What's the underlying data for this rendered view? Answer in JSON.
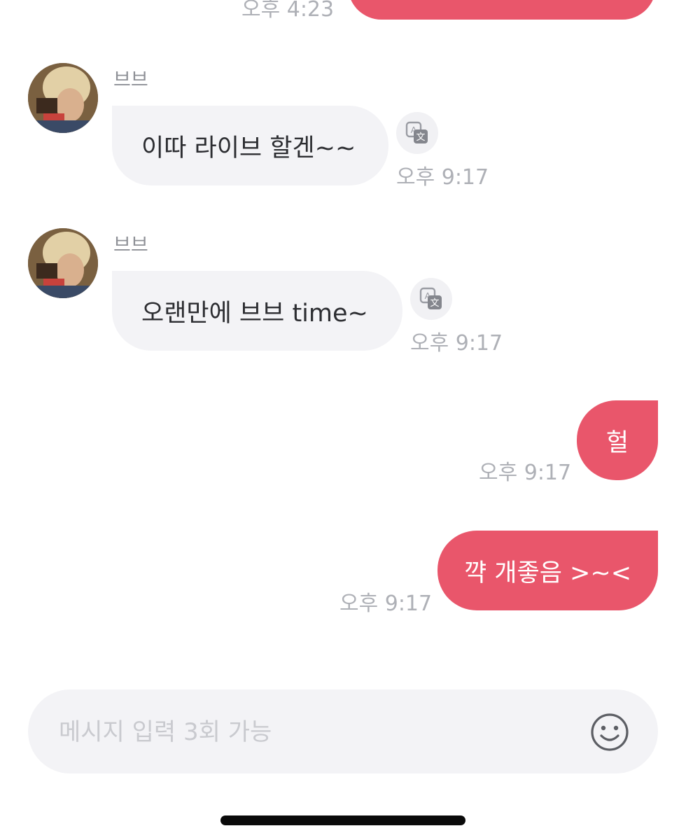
{
  "top_message": {
    "time": "오후 4:23"
  },
  "messages_in": [
    {
      "sender": "브브",
      "text": "이따 라이브 할겐~~",
      "time": "오후 9:17"
    },
    {
      "sender": "브브",
      "text": "오랜만에 브브 time~",
      "time": "오후 9:17"
    }
  ],
  "messages_out": [
    {
      "text": "헐",
      "time": "오후 9:17"
    },
    {
      "text": "꺅 개좋음 >~<",
      "time": "오후 9:17"
    }
  ],
  "composer": {
    "placeholder": "메시지 입력 3회 가능"
  },
  "icons": {
    "translate": "translate-icon",
    "emoji": "smiley-icon",
    "avatar": "avatar-photo"
  },
  "colors": {
    "outgoing_bubble": "#e9566b",
    "incoming_bubble": "#f3f3f6",
    "time_text": "#aeb0b6",
    "sender_text": "#8e9096",
    "composer_bg": "#f3f3f6"
  }
}
